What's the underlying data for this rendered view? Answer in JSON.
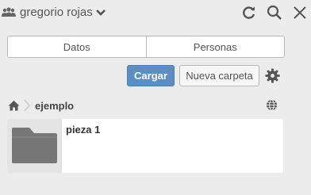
{
  "header": {
    "user_name": "gregorio rojas",
    "icons": [
      "users-icon",
      "chevron-down-icon",
      "refresh-icon",
      "search-icon",
      "close-icon"
    ]
  },
  "tabs": [
    {
      "label": "Datos",
      "active": true
    },
    {
      "label": "Personas",
      "active": false
    }
  ],
  "toolbar": {
    "upload_label": "Cargar",
    "new_folder_label": "Nueva carpeta",
    "accent_color": "#5b8fc4"
  },
  "breadcrumb": {
    "current": "ejemplo"
  },
  "items": [
    {
      "name": "pieza 1",
      "type": "folder"
    }
  ]
}
